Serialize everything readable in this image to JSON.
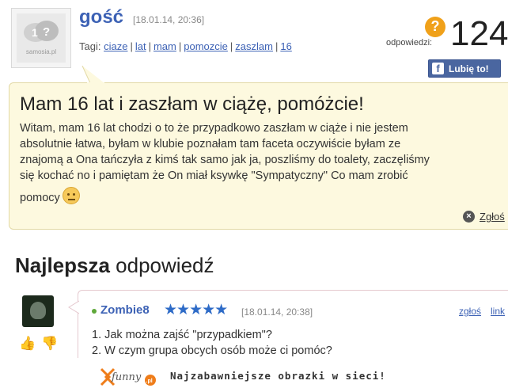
{
  "question": {
    "author": "gość",
    "date": "[18.01.14, 20:36]",
    "avatar_logo_text": "samosia.pl",
    "tags_label": "Tagi:",
    "tags": [
      "ciaze",
      "lat",
      "mam",
      "pomozcie",
      "zaszlam",
      "16"
    ],
    "answers_label": "odpowiedzi:",
    "answers_count": "124",
    "like_button_label": "Lubię to!",
    "title": "Mam 16 lat i zaszłam w ciążę, pomóżcie!",
    "body_lines": [
      "Witam, mam 16 lat chodzi o to że przypadkowo zaszłam w ciąże i nie jestem",
      "absolutnie łatwa, byłam w klubie poznałam tam faceta oczywiście byłam ze",
      "znajomą a Ona tańczyła z kimś tak samo jak ja, poszliśmy do toalety, zaczęliśmy",
      "się kochać no i pamiętam że On miał ksywkę \"Sympatyczny\" Co mam zrobić",
      "pomocy"
    ],
    "report_label": "Zgłoś"
  },
  "best_answer": {
    "heading_bold": "Najlepsza",
    "heading_rest": " odpowiedź",
    "user": "Zombie8",
    "stars": "★★★★★",
    "rating_stars": 5,
    "date": "[18.01.14, 20:38]",
    "report_label": "zgłoś",
    "link_label": "link",
    "lines": [
      "1. Jak można zajść \"przypadkiem\"?",
      "2. W czym grupa obcych osób może ci pomóc?"
    ]
  },
  "footer": {
    "logo_text": "funny",
    "logo_suffix": ".pl",
    "tagline": "Najzabawniejsze obrazki w sieci!"
  },
  "colors": {
    "link_blue": "#3d62b5",
    "bubble_bg": "#fdf9df",
    "facebook_blue": "#4a66a0",
    "answers_orange": "#f0a11a",
    "footer_orange": "#ef7d1a"
  }
}
